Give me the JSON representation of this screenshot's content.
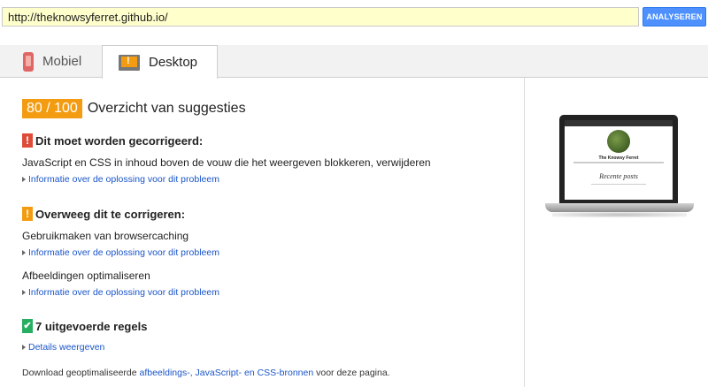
{
  "header": {
    "url_value": "http://theknowsyferret.github.io/",
    "analyze_label": "ANALYSEREN"
  },
  "tabs": [
    {
      "label": "Mobiel",
      "icon": "phone-icon",
      "active": false
    },
    {
      "label": "Desktop",
      "icon": "monitor-warning-icon",
      "active": true
    }
  ],
  "summary": {
    "score": "80 / 100",
    "title": "Overzicht van suggesties",
    "score_color": "#f39c12"
  },
  "sections": {
    "must_fix": {
      "heading": "Dit moet worden gecorrigeerd:",
      "color": "#dd4b39",
      "rules": [
        {
          "text": "JavaScript en CSS in inhoud boven de vouw die het weergeven blokkeren, verwijderen",
          "link": "Informatie over de oplossing voor dit probleem"
        }
      ]
    },
    "consider": {
      "heading": "Overweeg dit te corrigeren:",
      "color": "#f39c12",
      "rules": [
        {
          "text": "Gebruikmaken van browsercaching",
          "link": "Informatie over de oplossing voor dit probleem"
        },
        {
          "text": "Afbeeldingen optimaliseren",
          "link": "Informatie over de oplossing voor dit probleem"
        }
      ]
    },
    "passed": {
      "heading": "7 uitgevoerde regels",
      "color": "#27ae60",
      "link": "Details weergeven"
    }
  },
  "footer": {
    "prefix": "Download geoptimaliseerde ",
    "link": "afbeeldings-, JavaScript- en CSS-bronnen",
    "suffix": " voor deze pagina."
  },
  "preview": {
    "site_title": "The Knowsy Ferret",
    "heading": "Recente posts"
  }
}
